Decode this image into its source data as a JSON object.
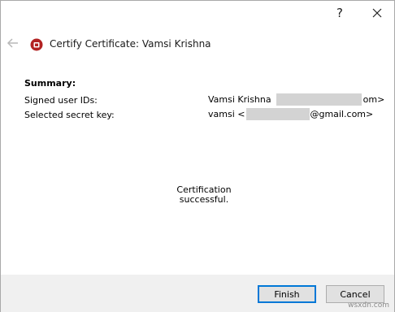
{
  "titlebar": {
    "help_label": "?",
    "close_icon": "close-icon"
  },
  "header": {
    "back_icon": "back-arrow-icon",
    "app_icon": "certificate-icon",
    "title": "Certify Certificate: Vamsi Krishna"
  },
  "summary": {
    "heading": "Summary:",
    "rows": [
      {
        "label": "Signed user IDs:",
        "value_prefix": "Vamsi Krishna",
        "value_suffix": "om>"
      },
      {
        "label": "Selected secret key:",
        "value_prefix": "vamsi <",
        "value_suffix": "@gmail.com>"
      }
    ]
  },
  "status": {
    "message": "Certification successful."
  },
  "footer": {
    "finish_label": "Finish",
    "cancel_label": "Cancel"
  },
  "watermark": "wsxdn.com",
  "colors": {
    "accent": "#0078d7",
    "footer_bg": "#f0f0f0",
    "redaction": "#d3d3d3"
  }
}
